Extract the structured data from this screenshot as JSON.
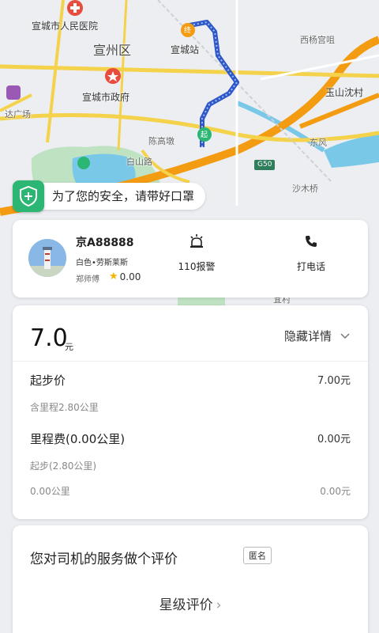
{
  "map": {
    "labels": {
      "hospital": "宣城市人民医院",
      "district": "宣州区",
      "station": "宣城站",
      "gov": "宣城市政府",
      "xiyang": "西杨宫咀",
      "yushan": "玉山沈村",
      "dongfeng": "东风",
      "shamu": "沙木桥",
      "chenhao": "陈高墩",
      "shanlu": "白山路",
      "plaza": "达广场",
      "highway": "G50",
      "endmark": "终",
      "startmark": "起",
      "bottom": "宜村"
    }
  },
  "safety_tip": "为了您的安全，请带好口罩",
  "driver": {
    "plate": "京A88888",
    "car": "白色•劳斯莱斯",
    "name": "郑师傅",
    "rating": "0.00",
    "police_label": "110报警",
    "call_label": "打电话"
  },
  "fare": {
    "total": "7.0",
    "unit": "元",
    "hide_label": "隐藏详情",
    "base_label": "起步价",
    "base_value": "7.00元",
    "base_note": "含里程2.80公里",
    "mileage_label": "里程费(0.00公里)",
    "mileage_value": "0.00元",
    "mileage_note": "起步(2.80公里)",
    "extra_label": "0.00公里",
    "extra_value": "0.00元"
  },
  "rate": {
    "title": "您对司机的服务做个评价",
    "badge": "匿名",
    "star_label": "星级评价"
  },
  "colors": {
    "route": "#2f57c8",
    "highway": "#f39c12",
    "road": "#f5d24b",
    "water": "#79c8e8",
    "green": "#2bb673"
  }
}
